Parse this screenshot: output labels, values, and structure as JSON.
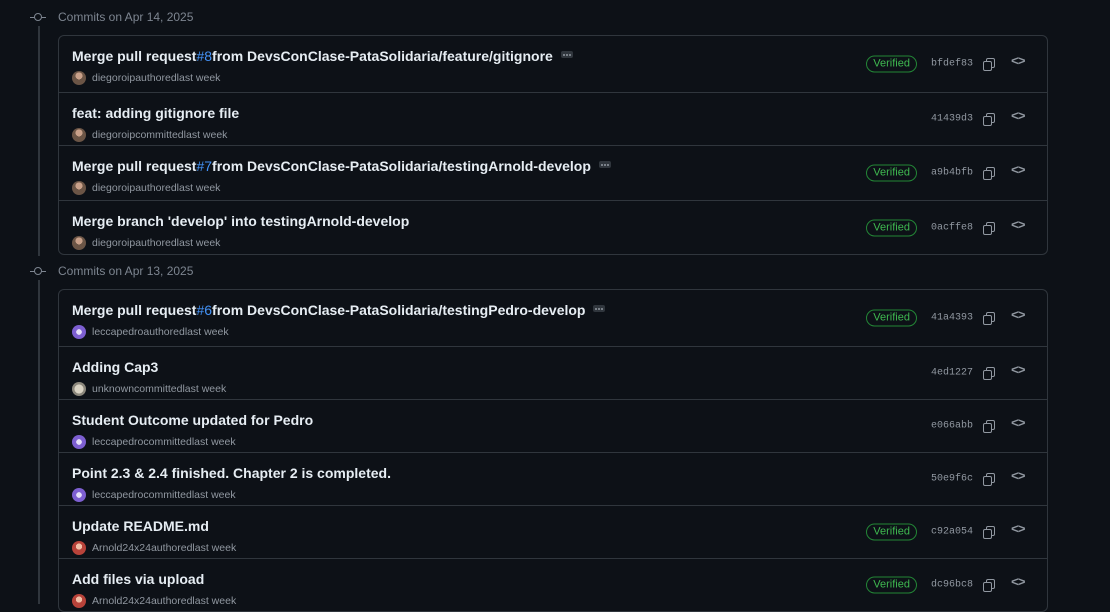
{
  "colors": {
    "background": "#0d1117",
    "border": "#30363d",
    "link": "#4493f8",
    "verified": "#3fb950",
    "muted": "#9198a1"
  },
  "icons": {
    "commit": "commit-icon",
    "copy": "copy-icon",
    "browse": "code-icon",
    "more": "ellipsis-icon"
  },
  "groups": [
    {
      "title": "Commits on Apr 14, 2025",
      "commits": [
        {
          "pre": "Merge pull request ",
          "pr": "#8",
          "post": " from DevsConClase-PataSolidaria/feature/gitignore",
          "ellipsis": true,
          "author": "diegoroip",
          "action": "authored",
          "time": "last week",
          "verified": "Verified",
          "sha": "bfdef83",
          "avatar": "diego"
        },
        {
          "pre": "feat: adding gitignore file",
          "pr": "",
          "post": "",
          "ellipsis": false,
          "author": "diegoroip",
          "action": "committed",
          "time": "last week",
          "verified": "",
          "sha": "41439d3",
          "avatar": "diego"
        },
        {
          "pre": "Merge pull request ",
          "pr": "#7",
          "post": " from DevsConClase-PataSolidaria/testingArnold-develop",
          "ellipsis": true,
          "author": "diegoroip",
          "action": "authored",
          "time": "last week",
          "verified": "Verified",
          "sha": "a9b4bfb",
          "avatar": "diego"
        },
        {
          "pre": "Merge branch 'develop' into testingArnold-develop",
          "pr": "",
          "post": "",
          "ellipsis": false,
          "author": "diegoroip",
          "action": "authored",
          "time": "last week",
          "verified": "Verified",
          "sha": "0acffe8",
          "avatar": "diego"
        }
      ]
    },
    {
      "title": "Commits on Apr 13, 2025",
      "commits": [
        {
          "pre": "Merge pull request ",
          "pr": "#6",
          "post": " from DevsConClase-PataSolidaria/testingPedro-develop",
          "ellipsis": true,
          "author": "leccapedro",
          "action": "authored",
          "time": "last week",
          "verified": "Verified",
          "sha": "41a4393",
          "avatar": "lecca"
        },
        {
          "pre": "Adding Cap3",
          "pr": "",
          "post": "",
          "ellipsis": false,
          "author": "unknown",
          "action": "committed",
          "time": "last week",
          "verified": "",
          "sha": "4ed1227",
          "avatar": "unknown"
        },
        {
          "pre": "Student Outcome updated for Pedro",
          "pr": "",
          "post": "",
          "ellipsis": false,
          "author": "leccapedro",
          "action": "committed",
          "time": "last week",
          "verified": "",
          "sha": "e066abb",
          "avatar": "lecca"
        },
        {
          "pre": "Point 2.3 & 2.4 finished. Chapter 2 is completed.",
          "pr": "",
          "post": "",
          "ellipsis": false,
          "author": "leccapedro",
          "action": "committed",
          "time": "last week",
          "verified": "",
          "sha": "50e9f6c",
          "avatar": "lecca"
        },
        {
          "pre": "Update README.md",
          "pr": "",
          "post": "",
          "ellipsis": false,
          "author": "Arnold24x24",
          "action": "authored",
          "time": "last week",
          "verified": "Verified",
          "sha": "c92a054",
          "avatar": "arnold"
        },
        {
          "pre": "Add files via upload",
          "pr": "",
          "post": "",
          "ellipsis": false,
          "author": "Arnold24x24",
          "action": "authored",
          "time": "last week",
          "verified": "Verified",
          "sha": "dc96bc8",
          "avatar": "arnold"
        }
      ]
    }
  ]
}
